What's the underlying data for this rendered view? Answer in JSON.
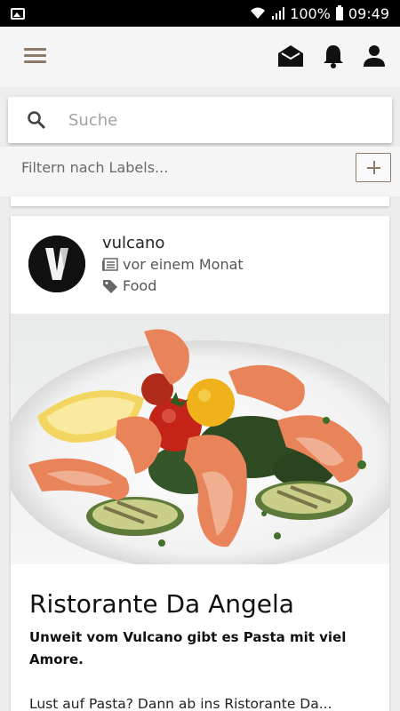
{
  "status_bar": {
    "battery": "100%",
    "time": "09:49"
  },
  "app_bar": {
    "icons": [
      "menu-icon",
      "inbox-icon",
      "bell-icon",
      "person-icon"
    ],
    "accent_color": "#8d7a68"
  },
  "search": {
    "placeholder": "Suche",
    "value": ""
  },
  "filter": {
    "placeholder": "Filtern nach Labels..."
  },
  "post": {
    "author": "vulcano",
    "avatar_letter": "V",
    "time": "vor einem Monat",
    "tag": "Food",
    "title": "Ristorante Da Angela",
    "subtitle": "Unweit vom Vulcano gibt es Pasta mit viel Amore.",
    "excerpt": "Lust auf Pasta? Dann ab ins Ristorante Da..."
  }
}
